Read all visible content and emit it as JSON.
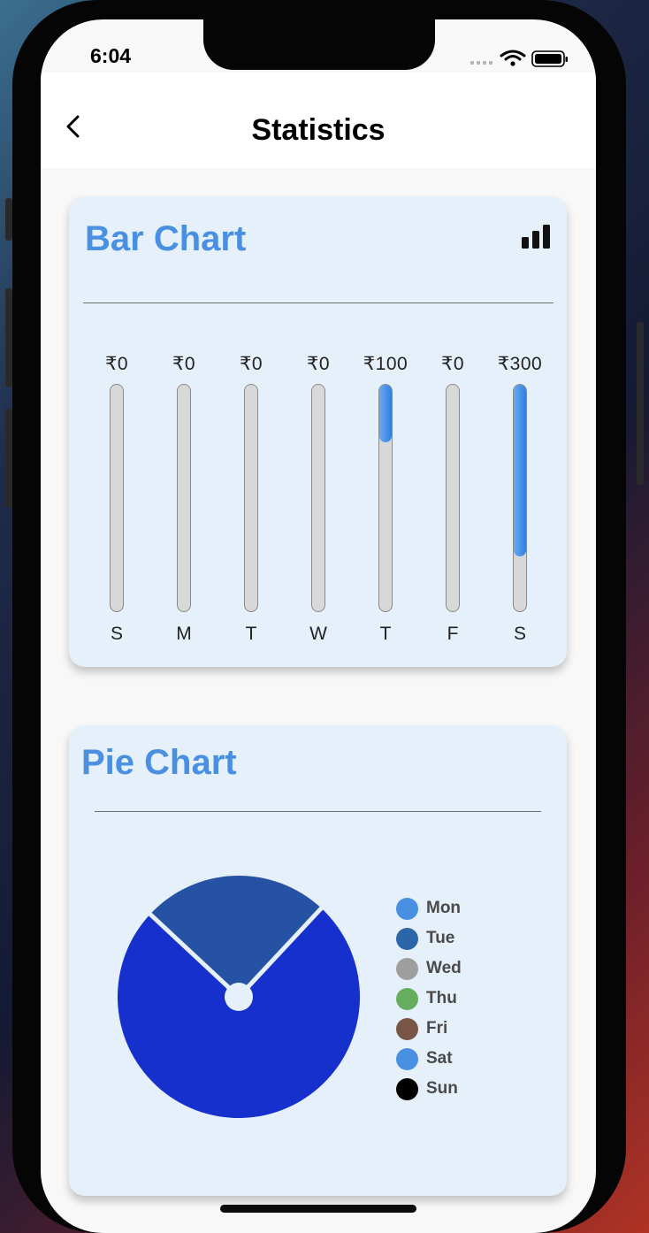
{
  "status_bar": {
    "time": "6:04"
  },
  "navbar": {
    "title": "Statistics",
    "back_icon": "chevron-left-icon"
  },
  "bar_card": {
    "title": "Bar Chart",
    "icon": "bar-chart-icon",
    "accent_color": "#4a90e2"
  },
  "pie_card": {
    "title": "Pie Chart"
  },
  "chart_data": [
    {
      "type": "bar",
      "categories": [
        "S",
        "M",
        "T",
        "W",
        "T",
        "F",
        "S"
      ],
      "value_labels": [
        "₹0",
        "₹0",
        "₹0",
        "₹0",
        "₹100",
        "₹0",
        "₹300"
      ],
      "values": [
        0,
        0,
        0,
        0,
        100,
        0,
        300
      ],
      "ylim": [
        0,
        400
      ],
      "colors": {
        "fill": "#3a86e4",
        "track": "#d8d8d8"
      }
    },
    {
      "type": "pie",
      "series": [
        {
          "name": "Mon",
          "value": 0,
          "color": "#4a90e2"
        },
        {
          "name": "Tue",
          "value": 100,
          "color": "#2552a3"
        },
        {
          "name": "Wed",
          "value": 0,
          "color": "#9e9e9e"
        },
        {
          "name": "Thu",
          "value": 0,
          "color": "#66ad5d"
        },
        {
          "name": "Fri",
          "value": 0,
          "color": "#795548"
        },
        {
          "name": "Sat",
          "value": 300,
          "color": "#1530cc"
        },
        {
          "name": "Sun",
          "value": 0,
          "color": "#000000"
        }
      ],
      "legend_colors": [
        "#4a90e2",
        "#2b66a8",
        "#9e9e9e",
        "#66ad5d",
        "#795548",
        "#4a90e2",
        "#000000"
      ],
      "legend_position": "right"
    }
  ]
}
